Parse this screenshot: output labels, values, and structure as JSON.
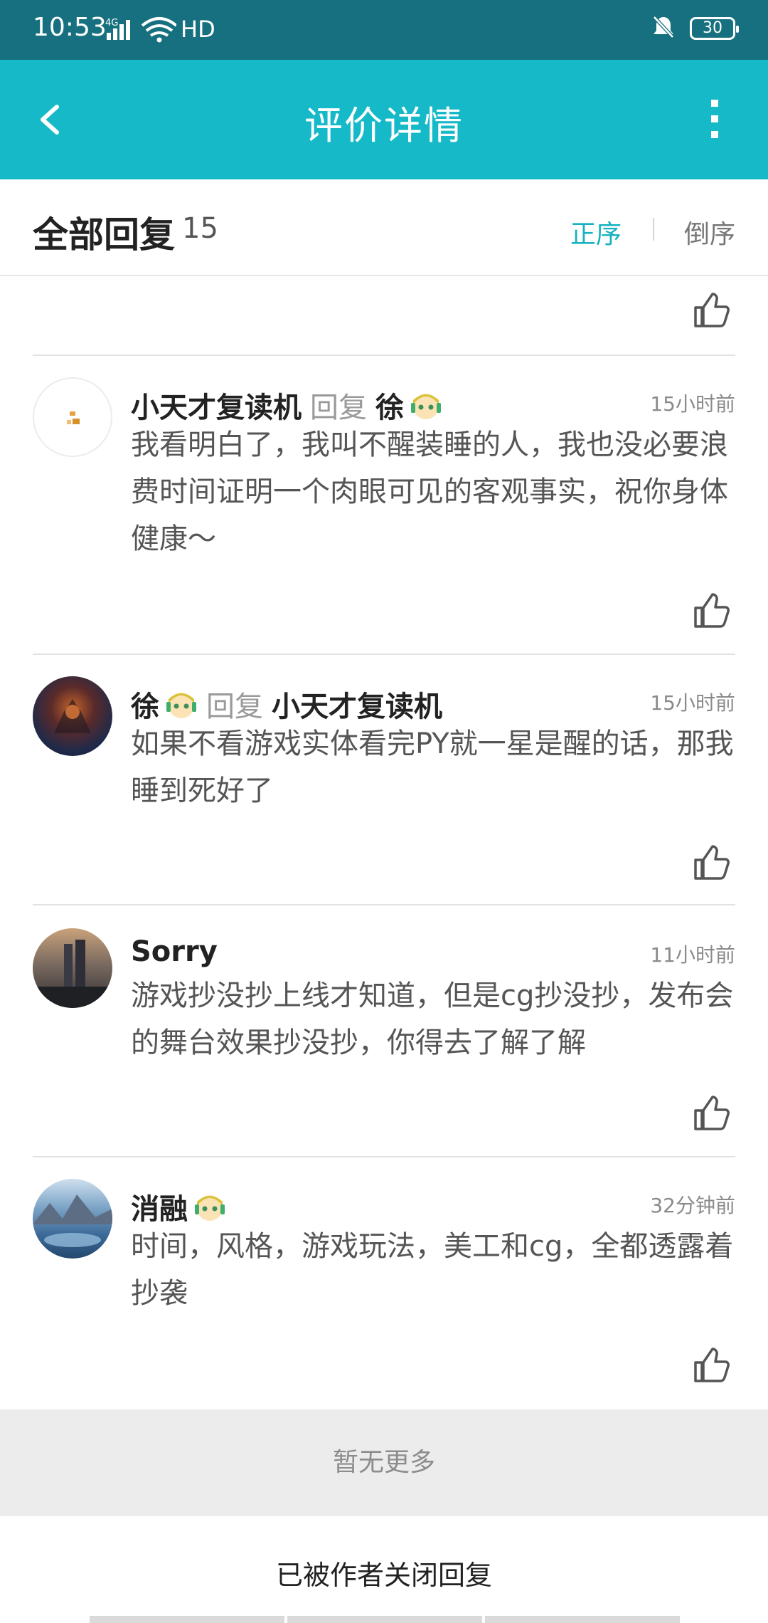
{
  "status": {
    "time": "10:53",
    "network": "4G",
    "wifi": "HD",
    "battery": "30"
  },
  "header": {
    "title": "评价详情"
  },
  "replies": {
    "label": "全部回复",
    "count": "15",
    "sort_asc": "正序",
    "sort_desc": "倒序"
  },
  "comments": [
    {
      "name": "小天才复读机",
      "reply_word": "回复",
      "target": "徐",
      "time": "15小时前",
      "text": "我看明白了，我叫不醒装睡的人，我也没必要浪费时间证明一个肉眼可见的客观事实，祝你身体健康～"
    },
    {
      "name": "徐",
      "reply_word": "回复",
      "target": "小天才复读机",
      "time": "15小时前",
      "text": "如果不看游戏实体看完PY就一星是醒的话，那我睡到死好了"
    },
    {
      "name": "Sorry",
      "time": "11小时前",
      "text": "游戏抄没抄上线才知道，但是cg抄没抄，发布会的舞台效果抄没抄，你得去了解了解"
    },
    {
      "name": "消融",
      "time": "32分钟前",
      "text": "时间，风格，游戏玩法，美工和cg，全都透露着抄袭"
    }
  ],
  "footer": {
    "no_more": "暂无更多",
    "closed": "已被作者关闭回复"
  }
}
